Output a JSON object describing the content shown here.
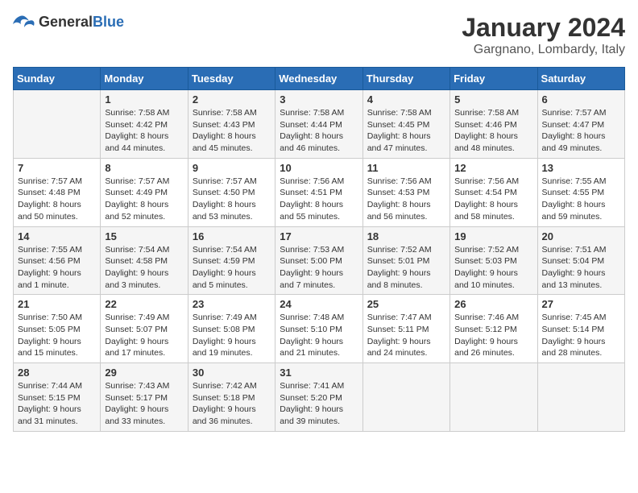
{
  "header": {
    "logo_general": "General",
    "logo_blue": "Blue",
    "month_title": "January 2024",
    "location": "Gargnano, Lombardy, Italy"
  },
  "weekdays": [
    "Sunday",
    "Monday",
    "Tuesday",
    "Wednesday",
    "Thursday",
    "Friday",
    "Saturday"
  ],
  "weeks": [
    [
      {
        "day": "",
        "info": ""
      },
      {
        "day": "1",
        "info": "Sunrise: 7:58 AM\nSunset: 4:42 PM\nDaylight: 8 hours\nand 44 minutes."
      },
      {
        "day": "2",
        "info": "Sunrise: 7:58 AM\nSunset: 4:43 PM\nDaylight: 8 hours\nand 45 minutes."
      },
      {
        "day": "3",
        "info": "Sunrise: 7:58 AM\nSunset: 4:44 PM\nDaylight: 8 hours\nand 46 minutes."
      },
      {
        "day": "4",
        "info": "Sunrise: 7:58 AM\nSunset: 4:45 PM\nDaylight: 8 hours\nand 47 minutes."
      },
      {
        "day": "5",
        "info": "Sunrise: 7:58 AM\nSunset: 4:46 PM\nDaylight: 8 hours\nand 48 minutes."
      },
      {
        "day": "6",
        "info": "Sunrise: 7:57 AM\nSunset: 4:47 PM\nDaylight: 8 hours\nand 49 minutes."
      }
    ],
    [
      {
        "day": "7",
        "info": "Sunrise: 7:57 AM\nSunset: 4:48 PM\nDaylight: 8 hours\nand 50 minutes."
      },
      {
        "day": "8",
        "info": "Sunrise: 7:57 AM\nSunset: 4:49 PM\nDaylight: 8 hours\nand 52 minutes."
      },
      {
        "day": "9",
        "info": "Sunrise: 7:57 AM\nSunset: 4:50 PM\nDaylight: 8 hours\nand 53 minutes."
      },
      {
        "day": "10",
        "info": "Sunrise: 7:56 AM\nSunset: 4:51 PM\nDaylight: 8 hours\nand 55 minutes."
      },
      {
        "day": "11",
        "info": "Sunrise: 7:56 AM\nSunset: 4:53 PM\nDaylight: 8 hours\nand 56 minutes."
      },
      {
        "day": "12",
        "info": "Sunrise: 7:56 AM\nSunset: 4:54 PM\nDaylight: 8 hours\nand 58 minutes."
      },
      {
        "day": "13",
        "info": "Sunrise: 7:55 AM\nSunset: 4:55 PM\nDaylight: 8 hours\nand 59 minutes."
      }
    ],
    [
      {
        "day": "14",
        "info": "Sunrise: 7:55 AM\nSunset: 4:56 PM\nDaylight: 9 hours\nand 1 minute."
      },
      {
        "day": "15",
        "info": "Sunrise: 7:54 AM\nSunset: 4:58 PM\nDaylight: 9 hours\nand 3 minutes."
      },
      {
        "day": "16",
        "info": "Sunrise: 7:54 AM\nSunset: 4:59 PM\nDaylight: 9 hours\nand 5 minutes."
      },
      {
        "day": "17",
        "info": "Sunrise: 7:53 AM\nSunset: 5:00 PM\nDaylight: 9 hours\nand 7 minutes."
      },
      {
        "day": "18",
        "info": "Sunrise: 7:52 AM\nSunset: 5:01 PM\nDaylight: 9 hours\nand 8 minutes."
      },
      {
        "day": "19",
        "info": "Sunrise: 7:52 AM\nSunset: 5:03 PM\nDaylight: 9 hours\nand 10 minutes."
      },
      {
        "day": "20",
        "info": "Sunrise: 7:51 AM\nSunset: 5:04 PM\nDaylight: 9 hours\nand 13 minutes."
      }
    ],
    [
      {
        "day": "21",
        "info": "Sunrise: 7:50 AM\nSunset: 5:05 PM\nDaylight: 9 hours\nand 15 minutes."
      },
      {
        "day": "22",
        "info": "Sunrise: 7:49 AM\nSunset: 5:07 PM\nDaylight: 9 hours\nand 17 minutes."
      },
      {
        "day": "23",
        "info": "Sunrise: 7:49 AM\nSunset: 5:08 PM\nDaylight: 9 hours\nand 19 minutes."
      },
      {
        "day": "24",
        "info": "Sunrise: 7:48 AM\nSunset: 5:10 PM\nDaylight: 9 hours\nand 21 minutes."
      },
      {
        "day": "25",
        "info": "Sunrise: 7:47 AM\nSunset: 5:11 PM\nDaylight: 9 hours\nand 24 minutes."
      },
      {
        "day": "26",
        "info": "Sunrise: 7:46 AM\nSunset: 5:12 PM\nDaylight: 9 hours\nand 26 minutes."
      },
      {
        "day": "27",
        "info": "Sunrise: 7:45 AM\nSunset: 5:14 PM\nDaylight: 9 hours\nand 28 minutes."
      }
    ],
    [
      {
        "day": "28",
        "info": "Sunrise: 7:44 AM\nSunset: 5:15 PM\nDaylight: 9 hours\nand 31 minutes."
      },
      {
        "day": "29",
        "info": "Sunrise: 7:43 AM\nSunset: 5:17 PM\nDaylight: 9 hours\nand 33 minutes."
      },
      {
        "day": "30",
        "info": "Sunrise: 7:42 AM\nSunset: 5:18 PM\nDaylight: 9 hours\nand 36 minutes."
      },
      {
        "day": "31",
        "info": "Sunrise: 7:41 AM\nSunset: 5:20 PM\nDaylight: 9 hours\nand 39 minutes."
      },
      {
        "day": "",
        "info": ""
      },
      {
        "day": "",
        "info": ""
      },
      {
        "day": "",
        "info": ""
      }
    ]
  ]
}
